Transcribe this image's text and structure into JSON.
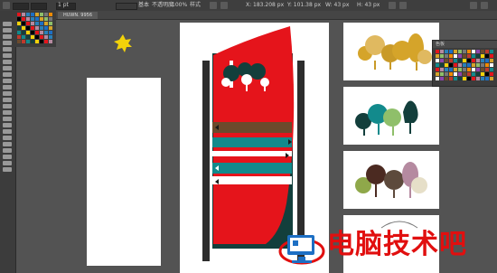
{
  "app": {
    "tab_title": "HUWN. 9956",
    "zoom": "100%",
    "stroke_label": "基本",
    "opacity_label": "不透明度",
    "opacity_value": "100%",
    "style_label": "样式",
    "position_x": "X: 183.208 px",
    "position_y": "Y: 101.38 px",
    "width_value": "W: 43 px",
    "height_value": "H: 43 px",
    "stroke_weight": "1 pt"
  },
  "panels": {
    "swatches_title": "色板"
  },
  "watermark": {
    "text": "电脑技术吧"
  },
  "colors": {
    "canvas": "#535353",
    "panel": "#3c3c3c",
    "red": "#e5141b",
    "dark_teal": "#133f3c",
    "teal": "#128a8c",
    "brown": "#6b4a2c",
    "gold": "#d5a42a",
    "pink": "#b58aa0",
    "sage": "#8fbf6a"
  }
}
